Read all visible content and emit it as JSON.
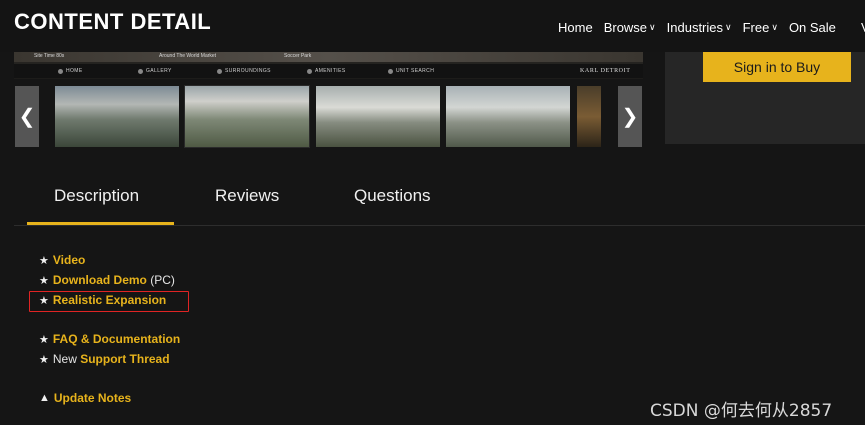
{
  "header": {
    "title": "CONTENT DETAIL",
    "nav": [
      {
        "label": "Home",
        "dropdown": false
      },
      {
        "label": "Browse",
        "dropdown": true
      },
      {
        "label": "Industries",
        "dropdown": true
      },
      {
        "label": "Free",
        "dropdown": true
      },
      {
        "label": "On Sale",
        "dropdown": false
      }
    ],
    "nav_edge": "V"
  },
  "hero": {
    "top_labels": [
      "Site Time 80s",
      "Around The World Market",
      "Soccer Park"
    ],
    "tabs": [
      "HOME",
      "GALLERY",
      "SURROUNDINGS",
      "AMENITIES",
      "UNIT SEARCH"
    ],
    "brand": "KARL DETROIT"
  },
  "gallery": {
    "prev_icon": "chevron-left-icon",
    "next_icon": "chevron-right-icon",
    "prev_glyph": "❮",
    "next_glyph": "❯"
  },
  "purchase": {
    "button_label": "Sign in to Buy",
    "accent": "#e7b31c"
  },
  "tabs": {
    "items": [
      "Description",
      "Reviews",
      "Questions"
    ],
    "active": "Description"
  },
  "links": {
    "video": "Video",
    "download_demo": "Download Demo",
    "download_suffix": " (PC)",
    "realistic_expansion": "Realistic Expansion",
    "faq": "FAQ & Documentation",
    "new_prefix": "New ",
    "support_thread": "Support Thread",
    "update_notes": "Update Notes",
    "star": "★",
    "triangle": "▲"
  },
  "watermark": "CSDN @何去何从2857"
}
